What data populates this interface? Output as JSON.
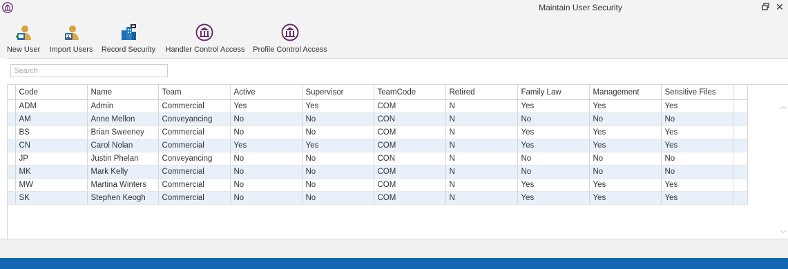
{
  "window": {
    "title": "Maintain User Security",
    "restore_glyph": "🗗",
    "close_glyph": "✕"
  },
  "toolbar": {
    "buttons": [
      {
        "label": "New User",
        "icon": "user-add-icon"
      },
      {
        "label": "Import Users",
        "icon": "user-import-icon"
      },
      {
        "label": "Record Security",
        "icon": "record-security-icon"
      },
      {
        "label": "Handler Control Access",
        "icon": "building-logo-icon"
      },
      {
        "label": "Profile Control Access",
        "icon": "building-logo-icon"
      }
    ]
  },
  "search": {
    "placeholder": "Search",
    "value": ""
  },
  "table": {
    "columns": [
      "Code",
      "Name",
      "Team",
      "Active",
      "Supervisor",
      "TeamCode",
      "Retired",
      "Family Law",
      "Management",
      "Sensitive Files"
    ],
    "rows": [
      [
        "ADM",
        "Admin",
        "Commercial",
        "Yes",
        "Yes",
        "COM",
        "N",
        "Yes",
        "Yes",
        "Yes"
      ],
      [
        "AM",
        "Anne Mellon",
        "Conveyancing",
        "No",
        "No",
        "CON",
        "N",
        "No",
        "No",
        "No"
      ],
      [
        "BS",
        "Brian Sweeney",
        "Commercial",
        "No",
        "No",
        "COM",
        "N",
        "Yes",
        "Yes",
        "Yes"
      ],
      [
        "CN",
        "Carol Nolan",
        "Commercial",
        "Yes",
        "Yes",
        "COM",
        "N",
        "Yes",
        "Yes",
        "Yes"
      ],
      [
        "JP",
        "Justin Phelan",
        "Conveyancing",
        "No",
        "No",
        "CON",
        "N",
        "No",
        "No",
        "No"
      ],
      [
        "MK",
        "Mark Kelly",
        "Commercial",
        "No",
        "No",
        "COM",
        "N",
        "No",
        "No",
        "No"
      ],
      [
        "MW",
        "Martina Winters",
        "Commercial",
        "No",
        "No",
        "COM",
        "N",
        "Yes",
        "Yes",
        "Yes"
      ],
      [
        "SK",
        "Stephen Keogh",
        "Commercial",
        "No",
        "No",
        "COM",
        "N",
        "Yes",
        "Yes",
        "Yes"
      ]
    ]
  },
  "colors": {
    "accent": "#1167b1",
    "row_alt": "#e8f0f9",
    "logo": "#6b2d6b"
  }
}
